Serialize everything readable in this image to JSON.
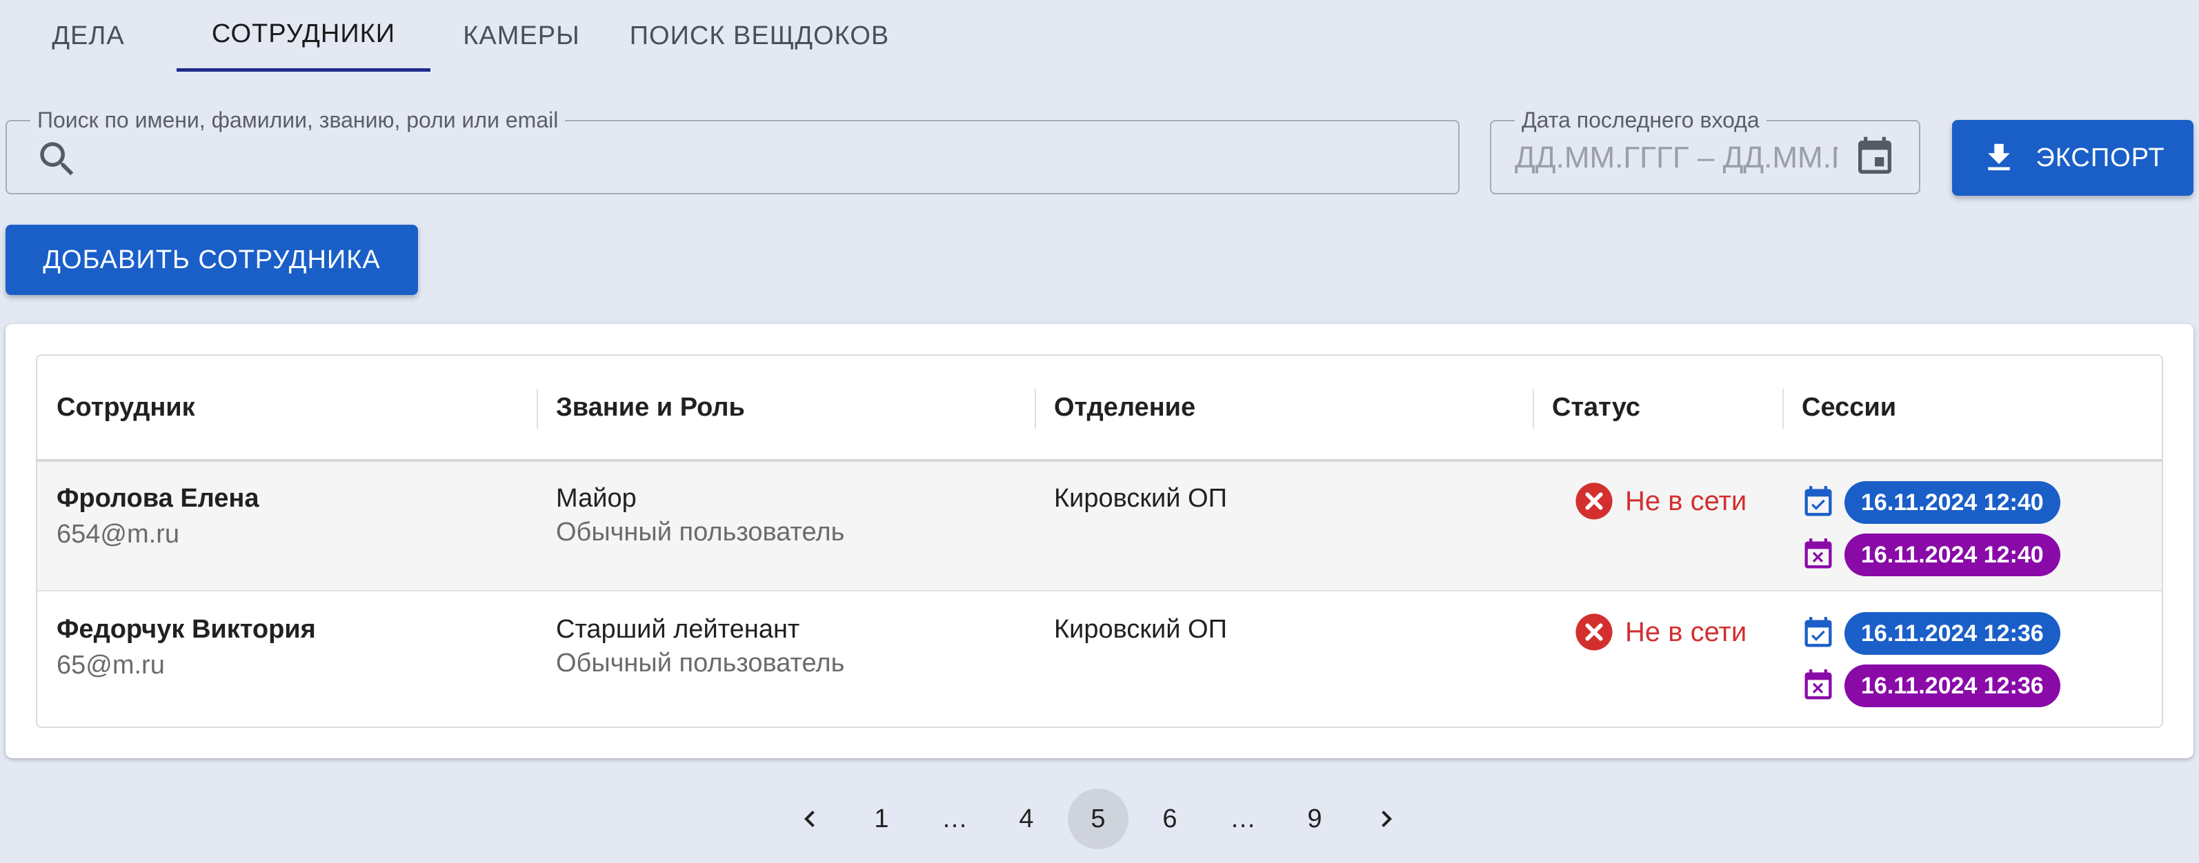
{
  "tabs": [
    {
      "label": "ДЕЛА",
      "active": false
    },
    {
      "label": "СОТРУДНИКИ",
      "active": true
    },
    {
      "label": "КАМЕРЫ",
      "active": false
    },
    {
      "label": "ПОИСК ВЕЩДОКОВ",
      "active": false
    }
  ],
  "search": {
    "label": "Поиск по имени, фамилии, званию, роли или email",
    "value": ""
  },
  "date_filter": {
    "label": "Дата последнего входа",
    "placeholder": "ДД.ММ.ГГГГ – ДД.ММ.ГГГГ"
  },
  "toolbar": {
    "export_label": "ЭКСПОРТ",
    "add_label": "ДОБАВИТЬ СОТРУДНИКА"
  },
  "table": {
    "columns": [
      "Сотрудник",
      "Звание и Роль",
      "Отделение",
      "Статус",
      "Сессии"
    ],
    "rows": [
      {
        "name": "Фролова Елена",
        "email": "654@m.ru",
        "rank": "Майор",
        "role": "Обычный пользователь",
        "department": "Кировский ОП",
        "status": "Не в сети",
        "session_start": "16.11.2024 12:40",
        "session_end": "16.11.2024 12:40"
      },
      {
        "name": "Федорчук Виктория",
        "email": "65@m.ru",
        "rank": "Старший лейтенант",
        "role": "Обычный пользователь",
        "department": "Кировский ОП",
        "status": "Не в сети",
        "session_start": "16.11.2024 12:36",
        "session_end": "16.11.2024 12:36"
      }
    ]
  },
  "pagination": {
    "items": [
      "1",
      "…",
      "4",
      "5",
      "6",
      "…",
      "9"
    ],
    "current": "5"
  },
  "colors": {
    "accent": "#1a5fc8",
    "session_end": "#8a0aa8",
    "offline": "#d32f2f",
    "tab_indicator": "#1d2d8c"
  },
  "icons": {
    "search": "search-icon",
    "date": "calendar-icon",
    "export": "download-icon",
    "status_offline": "error-circle-icon",
    "session_start": "calendar-check-icon",
    "session_end": "calendar-remove-icon",
    "prev": "chevron-left-icon",
    "next": "chevron-right-icon"
  }
}
